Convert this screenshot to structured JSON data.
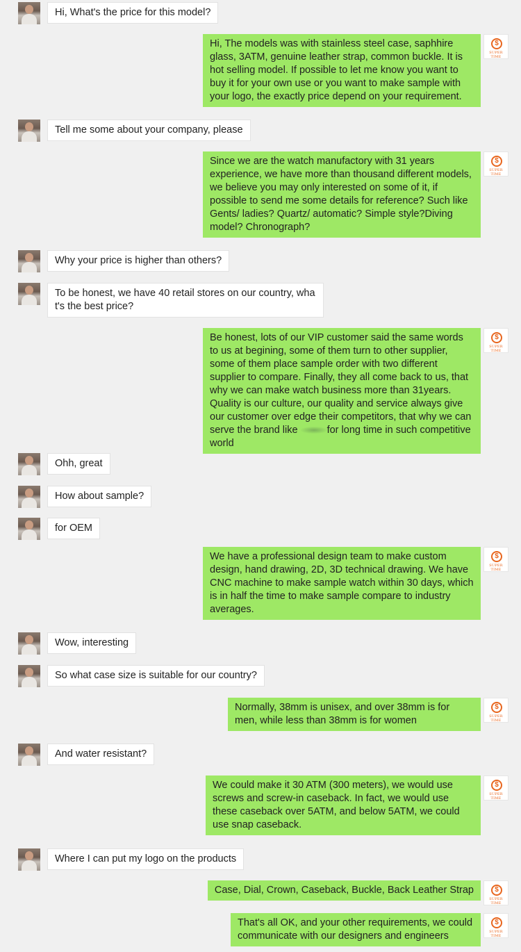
{
  "messages": [
    {
      "from": "customer",
      "text": "Hi, What's the price for this model?"
    },
    {
      "from": "supplier",
      "text": "Hi, The models was with stainless steel case, saphhire glass, 3ATM, genuine leather strap, common buckle. It is hot selling model. If possible to let me know you want to buy it for your own use or you want to make sample with your logo, the exactly price depend on your requirement."
    },
    {
      "from": "customer",
      "text": "Tell me some about your company, please"
    },
    {
      "from": "supplier",
      "text": "Since we are the watch manufactory with 31 years experience, we have more than thousand different models, we believe you may only interested on some of it, if possible to send me some details for reference? Such like Gents/ ladies? Quartz/ automatic? Simple style?Diving model? Chronograph?"
    },
    {
      "from": "customer",
      "text": "Why your price is higher than others?"
    },
    {
      "from": "customer",
      "text": "To be honest, we have 40 retail stores on our country, what's the best price?"
    },
    {
      "from": "supplier",
      "text": "Be honest, lots of our VIP customer said the same words to us at begining, some of them turn to other supplier, some of them place sample order with two different supplier to compare. Finally, they all come back to us, that why we can make watch business more than 31years. Quality is our culture, our quality and service always give our customer over edge their competitors, that why we can serve the brand like",
      "text_after": "for long time in such competitive world"
    },
    {
      "from": "customer",
      "text": "Ohh, great"
    },
    {
      "from": "customer",
      "text": "How about sample?"
    },
    {
      "from": "customer",
      "text": "for OEM"
    },
    {
      "from": "supplier",
      "text": "We have a professional design team to make custom design, hand drawing, 2D, 3D technical drawing. We have CNC machine to make sample watch within 30 days, which is in half the time to make sample compare to industry averages."
    },
    {
      "from": "customer",
      "text": "Wow, interesting"
    },
    {
      "from": "customer",
      "text": "So what case size is suitable for our country?"
    },
    {
      "from": "supplier",
      "text": "Normally, 38mm is unisex, and over 38mm is for men, while less than 38mm is for women"
    },
    {
      "from": "customer",
      "text": "And water resistant?"
    },
    {
      "from": "supplier",
      "text": "We could make it 30 ATM (300 meters), we would use screws and screw-in caseback. In fact, we would use these caseback over 5ATM, and below 5ATM, we could use snap caseback."
    },
    {
      "from": "customer",
      "text": "Where I can put my logo on the products"
    },
    {
      "from": "supplier",
      "text": "Case, Dial, Crown, Caseback, Buckle, Back Leather Strap"
    },
    {
      "from": "supplier",
      "text": "That's all OK, and your other requirements, we could communicate with our designers and engineers"
    }
  ],
  "supplier_logo": {
    "icon": "dollar-circle-icon",
    "text": "SUPER TIME",
    "color": "#e8661e"
  },
  "colors": {
    "background": "#f0f0f0",
    "incoming": "#ffffff",
    "outgoing": "#9ee865"
  }
}
